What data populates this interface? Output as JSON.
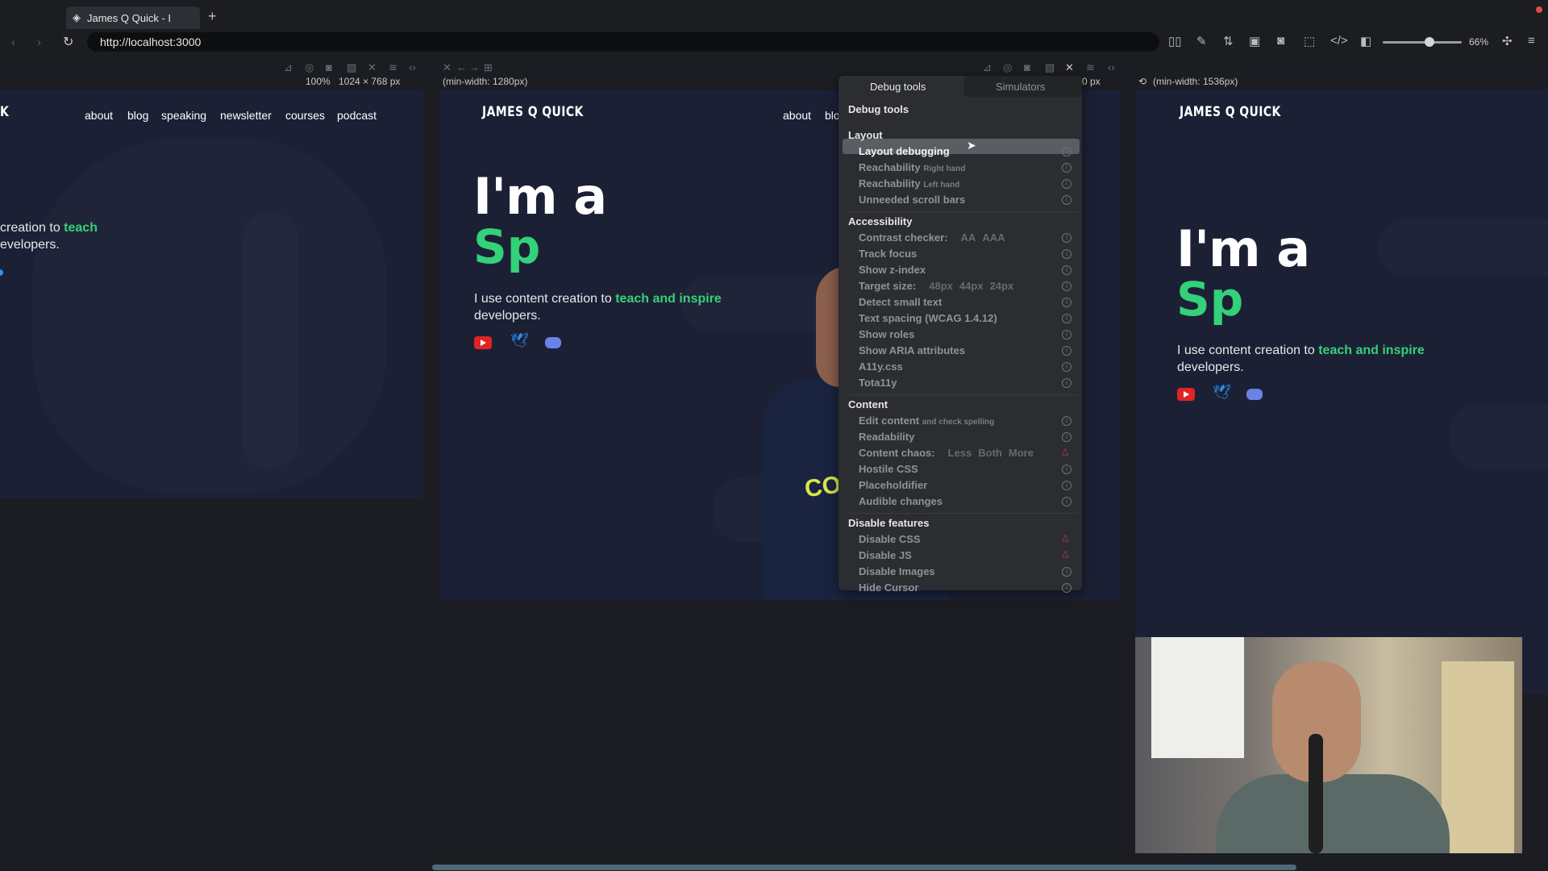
{
  "browser": {
    "tab_title": "James Q Quick - I",
    "url": "http://localhost:3000",
    "zoom": "66%"
  },
  "toolbar_left": {
    "zoom_info": "100%",
    "size_info": "1024 × 768 px"
  },
  "toolbar_middle": {
    "media_query": "(min-width: 1280px)"
  },
  "toolbar_right": {
    "size_info": "0 px",
    "media_query": "(min-width: 1536px)"
  },
  "site": {
    "logo": "JAMES Q QUICK",
    "nav": [
      "about",
      "blog",
      "speaking",
      "newsletter",
      "courses",
      "podcast"
    ],
    "hero_line1": "I'm a",
    "hero_line2": "Sp",
    "desc_prefix": "I use content creation to ",
    "desc_accent": "teach and inspire",
    "desc_suffix": "developers.",
    "pane1_logo_frag": "K",
    "pane1_desc1": "creation to",
    "pane1_accent": "teach",
    "pane1_desc2": "evelopers.",
    "pane2_nav": [
      "about",
      "blo"
    ],
    "shirt_text": "COMI"
  },
  "menu": {
    "tabs": [
      "Debug tools",
      "Simulators"
    ],
    "title": "Debug tools",
    "sections": [
      {
        "name": "Layout",
        "items": [
          {
            "label": "Layout debugging"
          },
          {
            "label": "Reachability",
            "sub": "Right hand"
          },
          {
            "label": "Reachability",
            "sub": "Left hand"
          },
          {
            "label": "Unneeded scroll bars"
          }
        ]
      },
      {
        "name": "Accessibility",
        "items": [
          {
            "label": "Contrast checker:",
            "options": [
              "AA",
              "AAA"
            ]
          },
          {
            "label": "Track focus"
          },
          {
            "label": "Show z-index"
          },
          {
            "label": "Target size:",
            "options": [
              "48px",
              "44px",
              "24px"
            ]
          },
          {
            "label": "Detect small text"
          },
          {
            "label": "Text spacing (WCAG 1.4.12)"
          },
          {
            "label": "Show roles"
          },
          {
            "label": "Show ARIA attributes"
          },
          {
            "label": "A11y.css"
          },
          {
            "label": "Tota11y"
          }
        ]
      },
      {
        "name": "Content",
        "items": [
          {
            "label": "Edit content",
            "sub": "and check spelling"
          },
          {
            "label": "Readability"
          },
          {
            "label": "Content chaos:",
            "options": [
              "Less",
              "Both",
              "More"
            ]
          },
          {
            "label": "Hostile CSS"
          },
          {
            "label": "Placeholdifier"
          },
          {
            "label": "Audible changes"
          }
        ]
      },
      {
        "name": "Disable features",
        "items": [
          {
            "label": "Disable CSS"
          },
          {
            "label": "Disable JS"
          },
          {
            "label": "Disable Images"
          },
          {
            "label": "Hide Cursor"
          }
        ]
      }
    ]
  },
  "colors": {
    "accent": "#33d17a",
    "page_bg": "#1c2035",
    "menu_bg": "#2b2d31",
    "warn": "#c2454a"
  }
}
